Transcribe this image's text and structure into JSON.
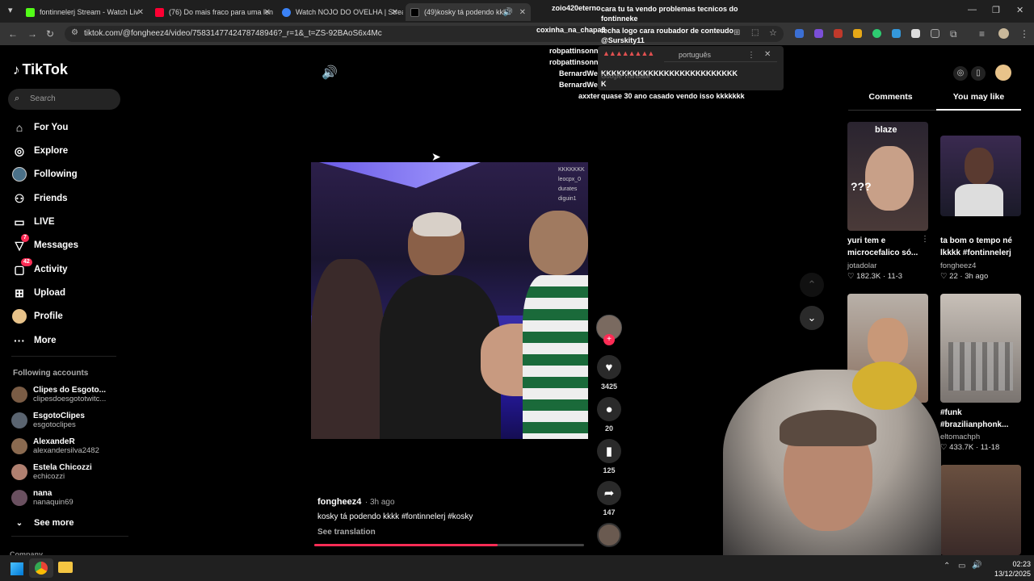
{
  "browser": {
    "tabs": [
      {
        "title": "fontinnelerj Stream - Watch Liv",
        "favicon_color": "#53fc18"
      },
      {
        "title": "(76) Do mais fraco para uma len",
        "favicon_color": "#ff0033"
      },
      {
        "title": "Watch NOJO DO OVELHA | Strea",
        "favicon_color": "#3b82f6"
      },
      {
        "title": "(49)kosky tá podendo kkkk",
        "favicon_color": "#ffffff"
      }
    ],
    "url": "tiktok.com/@fongheez4/video/7583147742478748946?_r=1&_t=ZS-92BAoS6x4Mc"
  },
  "tiktok": {
    "logo": "TikTok",
    "search_placeholder": "Search",
    "nav": [
      {
        "label": "For You",
        "icon": "home-icon"
      },
      {
        "label": "Explore",
        "icon": "compass-icon"
      },
      {
        "label": "Following",
        "icon": "following-avatar"
      },
      {
        "label": "Friends",
        "icon": "friends-icon"
      },
      {
        "label": "LIVE",
        "icon": "live-icon"
      },
      {
        "label": "Messages",
        "icon": "messages-icon",
        "badge": "7"
      },
      {
        "label": "Activity",
        "icon": "activity-icon",
        "badge": "42"
      },
      {
        "label": "Upload",
        "icon": "upload-icon"
      },
      {
        "label": "Profile",
        "icon": "profile-avatar"
      },
      {
        "label": "More",
        "icon": "more-icon"
      }
    ],
    "following_title": "Following accounts",
    "accounts": [
      {
        "name": "Clipes do Esgoto...",
        "handle": "clipesdoesgototwitc...",
        "color": "#7a5c45"
      },
      {
        "name": "EsgotoClipes",
        "handle": "esgotoclipes",
        "color": "#5a6470"
      },
      {
        "name": "AlexandeR",
        "handle": "alexandersilva2482",
        "color": "#8a6a50"
      },
      {
        "name": "Estela Chicozzi",
        "handle": "echicozzi",
        "color": "#b08070"
      },
      {
        "name": "nana",
        "handle": "nanaquin69",
        "color": "#6a5060"
      }
    ],
    "see_more": "See more",
    "company": "Company"
  },
  "video": {
    "author": "fongheez4",
    "time": "3h ago",
    "caption": "kosky tá podendo kkkk #fontinnelerj #kosky",
    "see_translation": "See translation",
    "progress": 0.68,
    "likes": "3425",
    "comments": "20",
    "saves": "125",
    "shares": "147"
  },
  "chat": [
    {
      "user": "zoio420eterno",
      "msg": "cara tu ta vendo problemas tecnicos do fontinneke",
      "color": "#53fc18"
    },
    {
      "user": "coxinha_na_chapa3",
      "msg": "fecha logo cara roubador de conteudo @Surskity11",
      "color": "#ff4b4b"
    },
    {
      "user": "robpattinsonnn",
      "msg": "",
      "color": "#9b59ff"
    },
    {
      "user": "robpattinsonnn",
      "msg": "",
      "color": "#9b59ff"
    },
    {
      "user": "BernardWell",
      "msg": "KKKKKKKKKKKKKKKKKKKKKKKKKK",
      "color": "#ff8c1a"
    },
    {
      "user": "BernardWell",
      "msg": "K",
      "color": "#ff8c1a"
    },
    {
      "user": "axxter",
      "msg": "quase 30 ano casado vendo isso kkkkkkk",
      "color": "#6f6fff"
    }
  ],
  "translate_popup": {
    "lang": "português",
    "footer": "Google Translate"
  },
  "right_panel": {
    "tabs": [
      "Comments",
      "You may like"
    ],
    "cards": [
      {
        "caption": "yuri tem e microcefalico só...",
        "author": "jotadolar",
        "likes": "182.3K",
        "date": "11-3"
      },
      {
        "caption": "ta bom o tempo né lkkkk #fontinnelerj",
        "author": "fongheez4",
        "likes": "22",
        "date": "3h ago"
      },
      {
        "caption": "",
        "author": "",
        "likes": "",
        "date": ""
      },
      {
        "caption": "#funk #brazilianphonk...",
        "author": "eltomachph",
        "likes": "433.7K",
        "date": "11-18"
      }
    ],
    "thumb1_brand": "blaze",
    "thumb1_text": "???"
  },
  "taskbar": {
    "time": "02:23",
    "date": "13/12/2025"
  }
}
